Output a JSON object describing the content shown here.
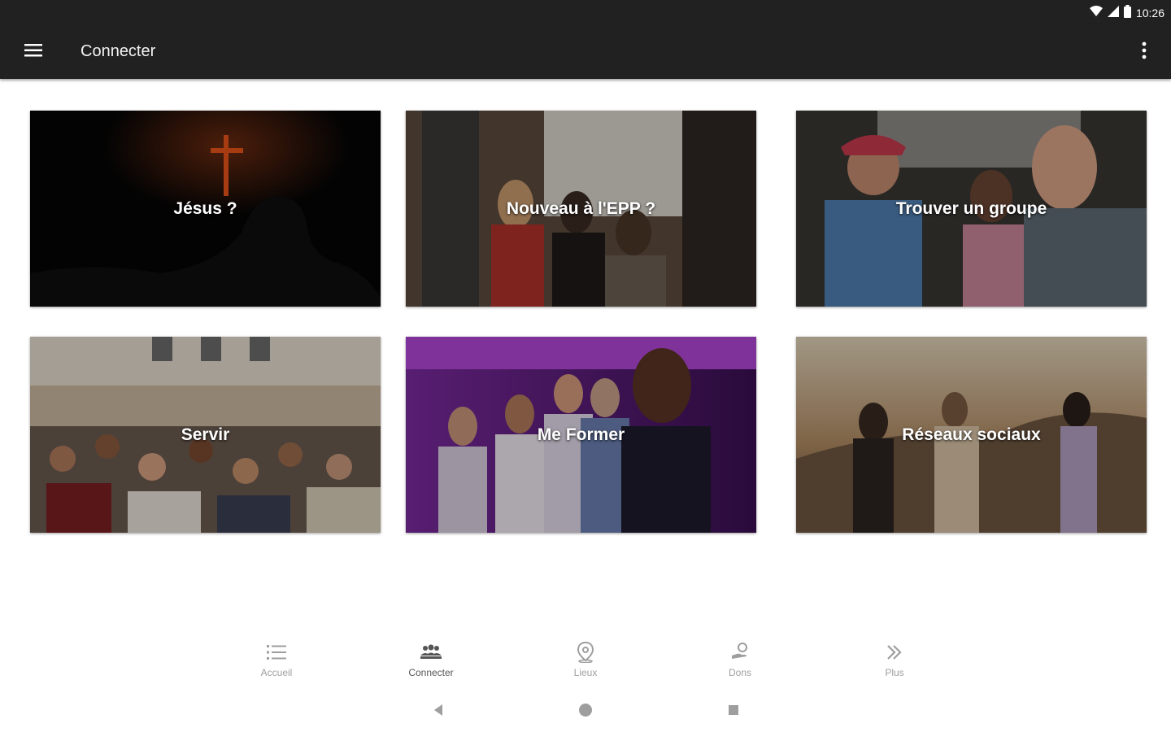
{
  "status_bar": {
    "time": "10:26"
  },
  "app_bar": {
    "title": "Connecter",
    "menu_icon": "hamburger-menu-icon",
    "more_icon": "more-vertical-icon"
  },
  "tiles": [
    {
      "label": "Jésus ?"
    },
    {
      "label": "Nouveau à l'EPP ?"
    },
    {
      "label": "Trouver un groupe"
    },
    {
      "label": "Servir"
    },
    {
      "label": "Me Former"
    },
    {
      "label": "Réseaux sociaux"
    }
  ],
  "bottom_nav": [
    {
      "label": "Accueil",
      "icon": "list-icon",
      "active": false
    },
    {
      "label": "Connecter",
      "icon": "people-group-icon",
      "active": true
    },
    {
      "label": "Lieux",
      "icon": "location-pin-icon",
      "active": false
    },
    {
      "label": "Dons",
      "icon": "donate-hand-icon",
      "active": false
    },
    {
      "label": "Plus",
      "icon": "double-chevron-right-icon",
      "active": false
    }
  ],
  "colors": {
    "bar": "#212121",
    "nav_inactive": "#9e9e9e",
    "nav_active": "#555555"
  }
}
